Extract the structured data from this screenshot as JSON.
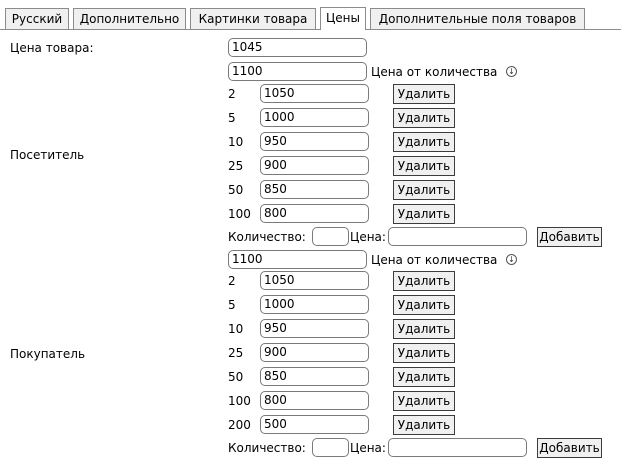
{
  "tabs": [
    {
      "label": "Русский",
      "active": false
    },
    {
      "label": "Дополнительно",
      "active": false
    },
    {
      "label": "Картинки товара",
      "active": false
    },
    {
      "label": "Цены",
      "active": true
    },
    {
      "label": "Дополнительные поля товаров",
      "active": false
    }
  ],
  "product_price": {
    "label": "Цена товара:",
    "value": "1045"
  },
  "visitor": {
    "label": "Посетитель",
    "base_price": "1100",
    "qty_price_label": "Цена от количества",
    "info_icon": "info-circle-down-icon",
    "tiers": [
      {
        "qty": "2",
        "price": "1050",
        "delete_label": "Удалить"
      },
      {
        "qty": "5",
        "price": "1000",
        "delete_label": "Удалить"
      },
      {
        "qty": "10",
        "price": "950",
        "delete_label": "Удалить"
      },
      {
        "qty": "25",
        "price": "900",
        "delete_label": "Удалить"
      },
      {
        "qty": "50",
        "price": "850",
        "delete_label": "Удалить"
      },
      {
        "qty": "100",
        "price": "800",
        "delete_label": "Удалить"
      }
    ],
    "add_row": {
      "qty_label": "Количество:",
      "price_label": "Цена:",
      "qty_value": "",
      "price_value": "",
      "add_label": "Добавить"
    }
  },
  "buyer": {
    "label": "Покупатель",
    "base_price": "1100",
    "qty_price_label": "Цена от количества",
    "info_icon": "info-circle-down-icon",
    "tiers": [
      {
        "qty": "2",
        "price": "1050",
        "delete_label": "Удалить"
      },
      {
        "qty": "5",
        "price": "1000",
        "delete_label": "Удалить"
      },
      {
        "qty": "10",
        "price": "950",
        "delete_label": "Удалить"
      },
      {
        "qty": "25",
        "price": "900",
        "delete_label": "Удалить"
      },
      {
        "qty": "50",
        "price": "850",
        "delete_label": "Удалить"
      },
      {
        "qty": "100",
        "price": "800",
        "delete_label": "Удалить"
      },
      {
        "qty": "200",
        "price": "500",
        "delete_label": "Удалить"
      }
    ],
    "add_row": {
      "qty_label": "Количество:",
      "price_label": "Цена:",
      "qty_value": "",
      "price_value": "",
      "add_label": "Добавить"
    }
  }
}
